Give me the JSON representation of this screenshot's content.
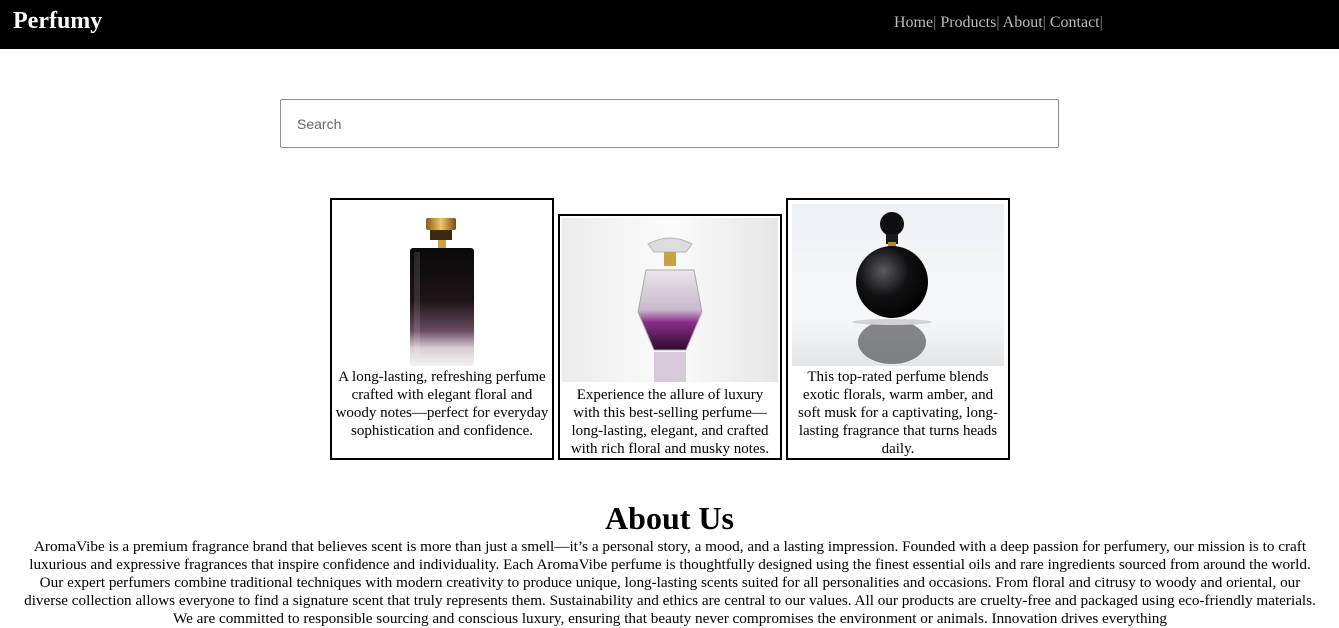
{
  "header": {
    "brand": "Perfumy",
    "nav": [
      "Home",
      "Products",
      "About",
      "Contact"
    ],
    "separator": "|"
  },
  "search": {
    "placeholder": "Search",
    "value": ""
  },
  "products": [
    {
      "image": "black-gradient-perfume-bottle-gold-cap",
      "description": "A long-lasting, refreshing perfume crafted with elegant floral and woody notes—perfect for everyday sophistication and confidence."
    },
    {
      "image": "clear-purple-perfume-bottle-reflection",
      "description": "Experience the allure of luxury with this best-selling perfume—long-lasting, elegant, and crafted with rich floral and musky notes."
    },
    {
      "image": "round-black-perfume-bottle-reflection",
      "description": "This top-rated perfume blends exotic florals, warm amber, and soft musk for a captivating, long-lasting fragrance that turns heads daily."
    }
  ],
  "about": {
    "title": "About Us",
    "text": "AromaVibe is a premium fragrance brand that believes scent is more than just a smell—it’s a personal story, a mood, and a lasting impression. Founded with a deep passion for perfumery, our mission is to craft luxurious and expressive fragrances that inspire confidence and individuality. Each AromaVibe perfume is thoughtfully designed using the finest essential oils and rare ingredients sourced from around the world. Our expert perfumers combine traditional techniques with modern creativity to produce unique, long-lasting scents suited for all personalities and occasions. From floral and citrusy to woody and oriental, our diverse collection allows everyone to find a signature scent that truly represents them. Sustainability and ethics are central to our values. All our products are cruelty-free and packaged using eco-friendly materials. We are committed to responsible sourcing and conscious luxury, ensuring that beauty never compromises the environment or animals. Innovation drives everything"
  },
  "colors": {
    "header_bg": "#000000",
    "brand_text": "#ffffff",
    "nav_text": "#bdbdbd"
  }
}
